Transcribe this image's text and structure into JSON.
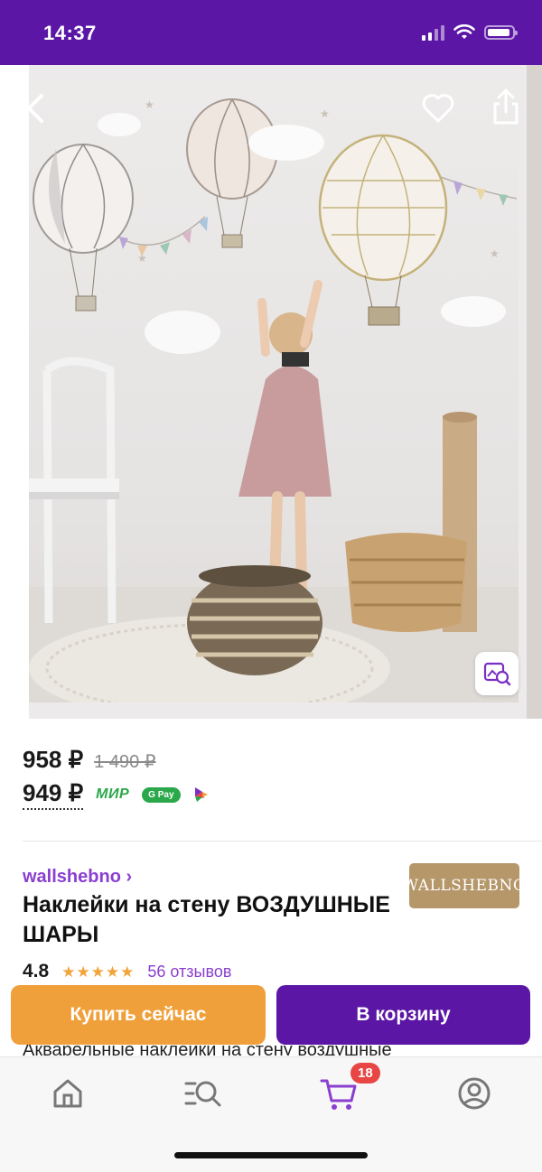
{
  "status_bar": {
    "time": "14:37"
  },
  "gallery": {
    "visual_search_icon": "image-search-icon",
    "back_icon": "chevron-left-icon",
    "favorite_icon": "heart-icon",
    "share_icon": "share-icon"
  },
  "price": {
    "current": "958 ₽",
    "old": "1 490 ₽",
    "card_price": "949 ₽",
    "payment_logos": [
      "МИР",
      "G Pay",
      "СБП"
    ]
  },
  "seller": {
    "name": "wallshebno ›",
    "logo_text": "WALLSHEBNO"
  },
  "product": {
    "title": "Наклейки на стену ВОЗДУШНЫЕ ШАРЫ",
    "rating": "4.8",
    "stars": "★★★★★",
    "reviews": "56 отзывов",
    "description_peek": "Акварельные наклейки на стену воздушные"
  },
  "actions": {
    "buy_now": "Купить сейчас",
    "add_to_cart": "В корзину"
  },
  "bottom_nav": {
    "cart_badge": "18"
  },
  "colors": {
    "brand": "#5b16a6",
    "accent": "#f0a03a",
    "link": "#8a3fd0",
    "badge": "#e84545"
  }
}
